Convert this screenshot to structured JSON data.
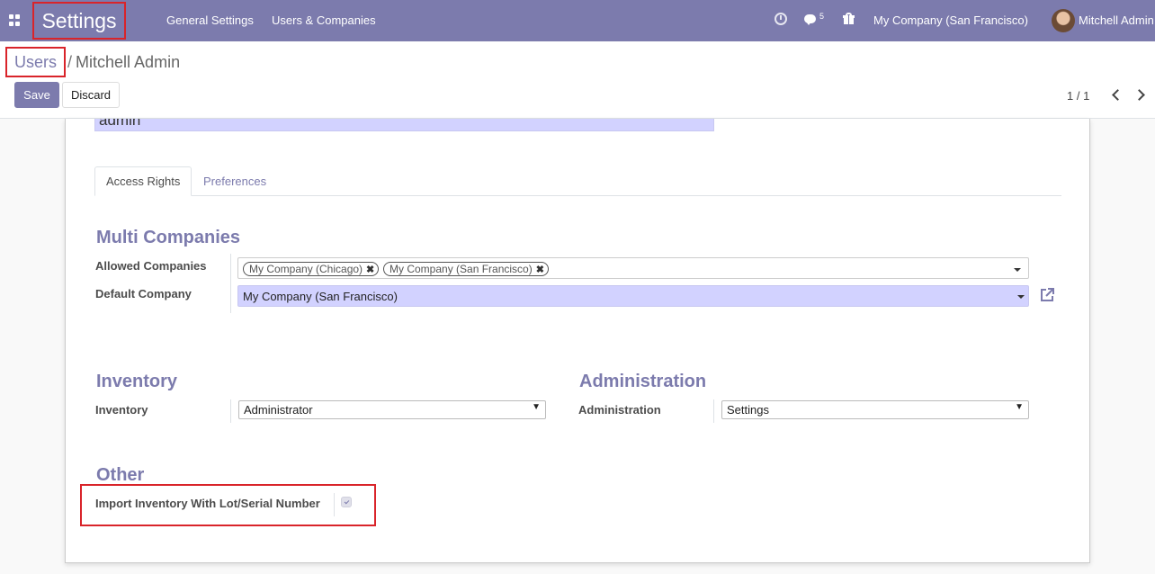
{
  "navbar": {
    "app_title": "Settings",
    "menu": [
      "General Settings",
      "Users & Companies"
    ],
    "chat_count": "5",
    "company": "My Company (San Francisco)",
    "user": "Mitchell Admin"
  },
  "breadcrumb": {
    "parent": "Users",
    "separator": "/",
    "current": "Mitchell Admin"
  },
  "buttons": {
    "save": "Save",
    "discard": "Discard"
  },
  "pager": {
    "value": "1 / 1"
  },
  "form": {
    "login_value": "admin",
    "tabs": [
      "Access Rights",
      "Preferences"
    ],
    "multi_companies": {
      "title": "Multi Companies",
      "allowed_label": "Allowed Companies",
      "allowed_tags": [
        "My Company (Chicago)",
        "My Company (San Francisco)"
      ],
      "default_label": "Default Company",
      "default_value": "My Company (San Francisco)"
    },
    "inventory": {
      "title": "Inventory",
      "label": "Inventory",
      "value": "Administrator"
    },
    "administration": {
      "title": "Administration",
      "label": "Administration",
      "value": "Settings"
    },
    "other": {
      "title": "Other",
      "label": "Import Inventory With Lot/Serial Number",
      "checked": true
    }
  },
  "colors": {
    "brand": "#7c7bad",
    "highlight": "#d9242a",
    "input_focus": "#d2d2ff"
  }
}
